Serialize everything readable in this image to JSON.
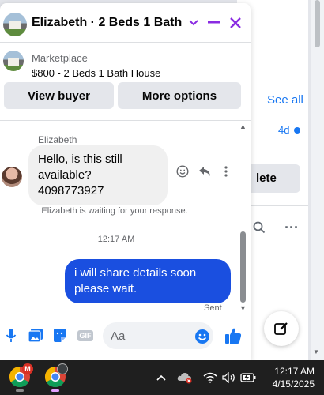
{
  "background": {
    "see_all": "See all",
    "time": "4d",
    "delete_partial": "lete"
  },
  "chat": {
    "header_title": "Elizabeth · 2 Beds 1 Bath H...",
    "marketplace_label": "Marketplace",
    "listing": "$800 - 2 Beds 1 Bath House",
    "view_buyer": "View buyer",
    "more_options": "More options",
    "sender_name": "Elizabeth",
    "incoming_message": "Hello, is this still available? 4098773927",
    "waiting_notice": "Elizabeth is waiting for your response.",
    "timestamp": "12:17 AM",
    "outgoing_message": "i will share details soon please wait.",
    "sent_status": "Sent",
    "input_placeholder": "Aa",
    "gif_label": "GIF"
  },
  "taskbar": {
    "time": "12:17 AM",
    "date": "4/15/2025",
    "chrome_badge": "M"
  },
  "colors": {
    "accent": "#8a2be2",
    "outgoing_bubble": "#1a4fe0",
    "facebook_blue": "#1877f2"
  }
}
